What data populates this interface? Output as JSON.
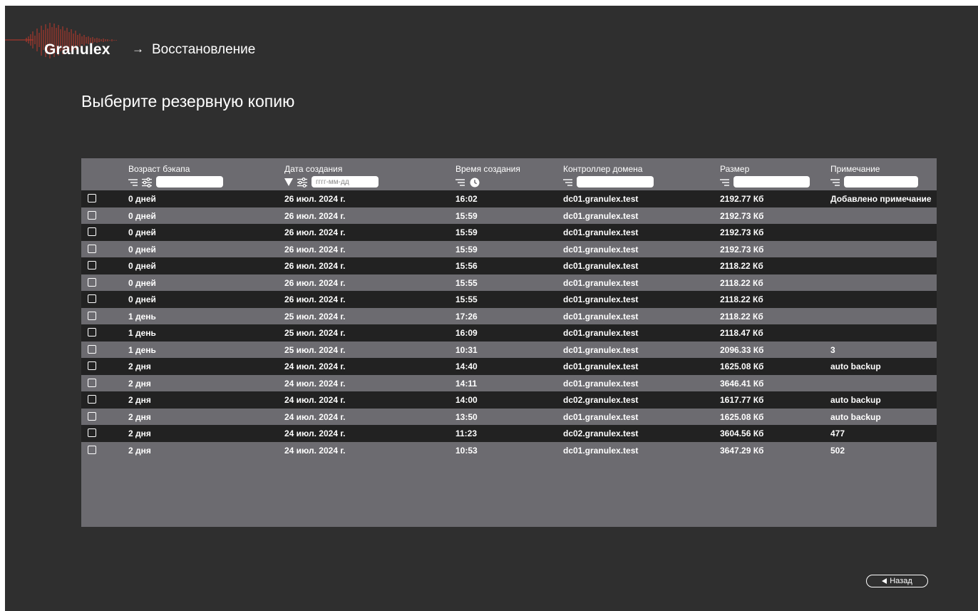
{
  "header": {
    "logo_text": "Granulex",
    "breadcrumb_arrow": "→",
    "breadcrumb_page": "Восстановление"
  },
  "page_title": "Выберите резервную копию",
  "table": {
    "columns": {
      "age": {
        "label": "Возраст бэкапа"
      },
      "date": {
        "label": "Дата создания",
        "placeholder": "гггг-мм-дд"
      },
      "time": {
        "label": "Время создания"
      },
      "dc": {
        "label": "Контроллер домена"
      },
      "size": {
        "label": "Размер"
      },
      "note": {
        "label": "Примечание"
      }
    },
    "rows": [
      {
        "age": "0 дней",
        "date": "26 июл. 2024 г.",
        "time": "16:02",
        "dc": "dc01.granulex.test",
        "size": "2192.77 Кб",
        "note": "Добавлено примечание"
      },
      {
        "age": "0 дней",
        "date": "26 июл. 2024 г.",
        "time": "15:59",
        "dc": "dc01.granulex.test",
        "size": "2192.73 Кб",
        "note": ""
      },
      {
        "age": "0 дней",
        "date": "26 июл. 2024 г.",
        "time": "15:59",
        "dc": "dc01.granulex.test",
        "size": "2192.73 Кб",
        "note": ""
      },
      {
        "age": "0 дней",
        "date": "26 июл. 2024 г.",
        "time": "15:59",
        "dc": "dc01.granulex.test",
        "size": "2192.73 Кб",
        "note": ""
      },
      {
        "age": "0 дней",
        "date": "26 июл. 2024 г.",
        "time": "15:56",
        "dc": "dc01.granulex.test",
        "size": "2118.22 Кб",
        "note": ""
      },
      {
        "age": "0 дней",
        "date": "26 июл. 2024 г.",
        "time": "15:55",
        "dc": "dc01.granulex.test",
        "size": "2118.22 Кб",
        "note": ""
      },
      {
        "age": "0 дней",
        "date": "26 июл. 2024 г.",
        "time": "15:55",
        "dc": "dc01.granulex.test",
        "size": "2118.22 Кб",
        "note": ""
      },
      {
        "age": "1 день",
        "date": "25 июл. 2024 г.",
        "time": "17:26",
        "dc": "dc01.granulex.test",
        "size": "2118.22 Кб",
        "note": ""
      },
      {
        "age": "1 день",
        "date": "25 июл. 2024 г.",
        "time": "16:09",
        "dc": "dc01.granulex.test",
        "size": "2118.47 Кб",
        "note": ""
      },
      {
        "age": "1 день",
        "date": "25 июл. 2024 г.",
        "time": "10:31",
        "dc": "dc01.granulex.test",
        "size": "2096.33 Кб",
        "note": "3"
      },
      {
        "age": "2 дня",
        "date": "24 июл. 2024 г.",
        "time": "14:40",
        "dc": "dc01.granulex.test",
        "size": "1625.08 Кб",
        "note": "auto backup"
      },
      {
        "age": "2 дня",
        "date": "24 июл. 2024 г.",
        "time": "14:11",
        "dc": "dc01.granulex.test",
        "size": "3646.41 Кб",
        "note": ""
      },
      {
        "age": "2 дня",
        "date": "24 июл. 2024 г.",
        "time": "14:00",
        "dc": "dc02.granulex.test",
        "size": "1617.77 Кб",
        "note": "auto backup"
      },
      {
        "age": "2 дня",
        "date": "24 июл. 2024 г.",
        "time": "13:50",
        "dc": "dc01.granulex.test",
        "size": "1625.08 Кб",
        "note": "auto backup"
      },
      {
        "age": "2 дня",
        "date": "24 июл. 2024 г.",
        "time": "11:23",
        "dc": "dc02.granulex.test",
        "size": "3604.56 Кб",
        "note": "477"
      },
      {
        "age": "2 дня",
        "date": "24 июл. 2024 г.",
        "time": "10:53",
        "dc": "dc01.granulex.test",
        "size": "3647.29 Кб",
        "note": "502"
      }
    ]
  },
  "footer": {
    "back_label": "Назад"
  },
  "colors": {
    "background": "#2f2f2f",
    "row_dark": "#222222",
    "row_light": "#6c6b70",
    "logo_accent": "#c0392b"
  },
  "icons": {
    "sort": "sort-lines-icon",
    "filter": "filter-sliders-icon",
    "sort_desc": "triangle-down-icon",
    "time": "clock-icon",
    "back": "triangle-left-icon",
    "checkbox": "checkbox"
  }
}
